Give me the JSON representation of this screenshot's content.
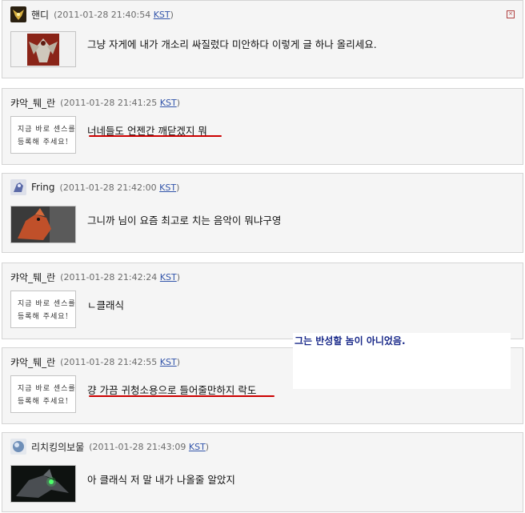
{
  "comments": [
    {
      "author": "핸디",
      "timestamp": "(2011-01-28 21:40:54",
      "tz": "KST",
      "tz_close": ")",
      "text": "그냥 자게에 내가 개소리 싸질렀다 미안하다 이렇게 글 하나 올리세요.",
      "avatar": "bat-emblem-icon"
    },
    {
      "author": "캬악_퉤_란",
      "timestamp": "(2011-01-28 21:41:25",
      "tz": "KST",
      "tz_close": ")",
      "text": "너네들도 언젠간 깨닫겠지 뭐",
      "thumb_line1": "지금 바로 센스를",
      "thumb_line2": "등록해 주세요!"
    },
    {
      "author": "Fring",
      "timestamp": "(2011-01-28 21:42:00",
      "tz": "KST",
      "tz_close": ")",
      "text": "그니까 님이 요즘 최고로 치는 음악이 뭐냐구영",
      "avatar": "robot-avatar-icon"
    },
    {
      "author": "캬악_퉤_란",
      "timestamp": "(2011-01-28 21:42:24",
      "tz": "KST",
      "tz_close": ")",
      "text": "ㄴ클래식",
      "thumb_line1": "지금 바로 센스를",
      "thumb_line2": "등록해 주세요!"
    },
    {
      "author": "캬악_퉤_란",
      "timestamp": "(2011-01-28 21:42:55",
      "tz": "KST",
      "tz_close": ")",
      "text": "걍 가끔 귀청소용으로 들어줄만하지 락도",
      "thumb_line1": "지금 바로 센스를",
      "thumb_line2": "등록해 주세요!"
    },
    {
      "author": "리치킹의보물",
      "timestamp": "(2011-01-28 21:43:09",
      "tz": "KST",
      "tz_close": ")",
      "text": "아 클래식 저 말 내가 나올줄 알았지",
      "avatar": "orb-avatar-icon"
    }
  ],
  "overlay_note": "그는 반성할 놈이 아니었음.",
  "colors": {
    "underline": "#cc0000",
    "note": "#1a2a8a",
    "link": "#3355aa"
  }
}
